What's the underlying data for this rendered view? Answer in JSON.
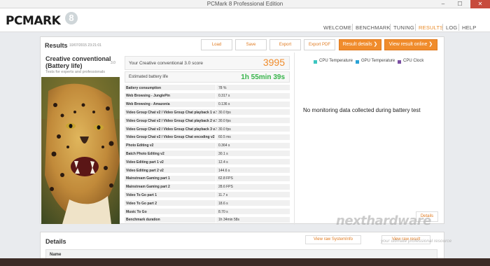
{
  "window": {
    "title": "PCMark 8 Professional Edition",
    "min": "–",
    "max": "☐",
    "close": "✕"
  },
  "app": {
    "logo": "PCMARK",
    "logo_num": "8"
  },
  "nav": [
    {
      "label": "WELCOME",
      "active": false
    },
    {
      "label": "BENCHMARK",
      "active": false
    },
    {
      "label": "TUNING",
      "active": false
    },
    {
      "label": "RESULTS",
      "active": true
    },
    {
      "label": "LOG",
      "active": false
    },
    {
      "label": "HELP",
      "active": false
    }
  ],
  "results": {
    "heading": "Results",
    "date": "10/07/2015 23:21:01",
    "buttons": {
      "load": "Load",
      "save": "Save",
      "export": "Export",
      "export_pdf": "Export PDF",
      "result_details": "Result details ❯",
      "view_online": "View result online ❯"
    },
    "test": {
      "title": "Creative conventional (Battery life)",
      "version": "3.0",
      "subtitle": "Tests for experts and professionals"
    },
    "score": {
      "label": "Your Creative conventional 3.0 score",
      "value": "3995"
    },
    "battery": {
      "label": "Estimated battery life",
      "value": "1h 55min 39s"
    },
    "subscores": [
      {
        "name": "Battery consumption",
        "value": "78 %"
      },
      {
        "name": "Web Browsing - JunglePin",
        "value": "0.317 s"
      },
      {
        "name": "Web Browsing - Amazonia",
        "value": "0.136 s"
      },
      {
        "name": "Video Group Chat v2 / Video Group Chat playback 1 v2",
        "value": "30.0 fps"
      },
      {
        "name": "Video Group Chat v2 / Video Group Chat playback 2 v2",
        "value": "30.0 fps"
      },
      {
        "name": "Video Group Chat v2 / Video Group Chat playback 3 v2",
        "value": "30.0 fps"
      },
      {
        "name": "Video Group Chat v2 / Video Group Chat encoding v2",
        "value": "60.5 ms"
      },
      {
        "name": "Photo Editing v2",
        "value": "0.364 s"
      },
      {
        "name": "Batch Photo Editing v2",
        "value": "30.1 s"
      },
      {
        "name": "Video Editing part 1 v2",
        "value": "12.4 s"
      },
      {
        "name": "Video Editing part 2 v2",
        "value": "144.6 s"
      },
      {
        "name": "Mainstream Gaming part 1",
        "value": "62.8 FPS"
      },
      {
        "name": "Mainstream Gaming part 2",
        "value": "28.6 FPS"
      },
      {
        "name": "Video To Go part 1",
        "value": "11.7 s"
      },
      {
        "name": "Video To Go part 2",
        "value": "18.6 s"
      },
      {
        "name": "Music To Go",
        "value": "8.70 s"
      },
      {
        "name": "Benchmark duration",
        "value": "1h 34min 58s"
      }
    ],
    "monitoring": {
      "legend": [
        {
          "label": "CPU Temperature",
          "color": "#3cc6c0"
        },
        {
          "label": "GPU Temperature",
          "color": "#2aa3d6"
        },
        {
          "label": "CPU Clock",
          "color": "#7b4fa3"
        }
      ],
      "message": "No monitoring data collected during battery test",
      "details_button": "Details"
    }
  },
  "details": {
    "heading": "Details",
    "view_systeminfo": "View raw SystemInfo",
    "view_result": "View raw result",
    "col_name": "Name"
  },
  "watermark": {
    "text": "nexthardware",
    "tagline": "your ultimate professional resource"
  },
  "colors": {
    "accent": "#f08c2c",
    "battery_green": "#37b44a"
  }
}
